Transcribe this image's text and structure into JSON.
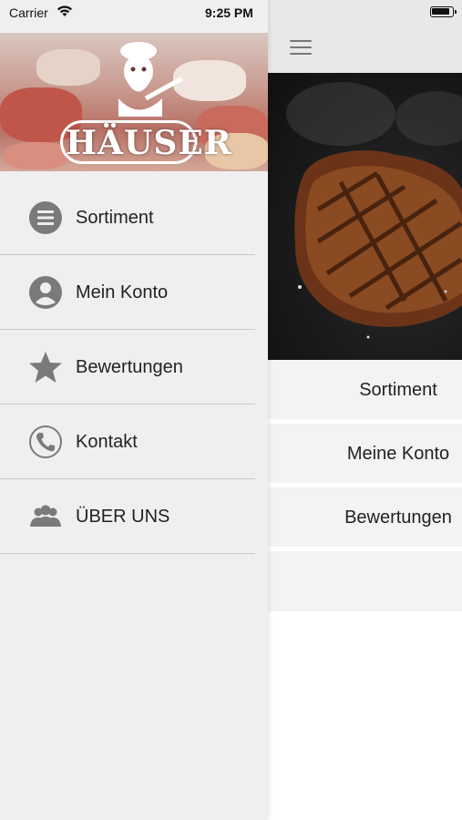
{
  "status": {
    "carrier": "Carrier",
    "time": "9:25 PM"
  },
  "brand": {
    "logo_text": "HÄUSER"
  },
  "drawer_menu": [
    {
      "label": "Sortiment",
      "icon": "list-icon"
    },
    {
      "label": "Mein Konto",
      "icon": "account-icon"
    },
    {
      "label": "Bewertungen",
      "icon": "star-icon"
    },
    {
      "label": "Kontakt",
      "icon": "phone-icon"
    },
    {
      "label": "ÜBER UNS",
      "icon": "users-icon"
    }
  ],
  "main_menu": [
    {
      "label": "Sortiment"
    },
    {
      "label": "Meine Konto"
    },
    {
      "label": "Bewertungen"
    }
  ],
  "colors": {
    "drawer_bg": "#efefef",
    "icon_gray": "#7a7a7a",
    "divider": "#c9c9c9"
  }
}
